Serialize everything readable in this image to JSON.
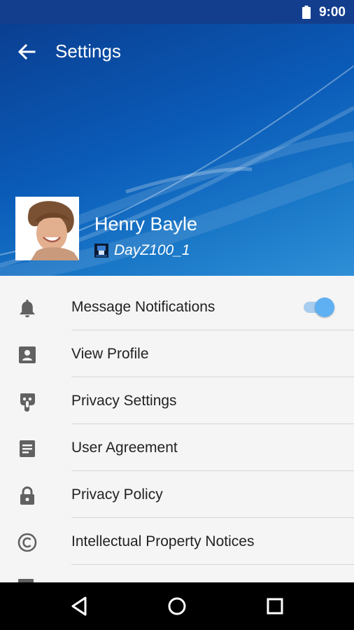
{
  "status_bar": {
    "time": "9:00",
    "battery_icon": "battery-full-icon"
  },
  "header": {
    "title": "Settings",
    "back_icon": "arrow-back-icon",
    "user": {
      "name": "Henry Bayle",
      "handle": "DayZ100_1"
    }
  },
  "settings": {
    "items": [
      {
        "label": "Message Notifications",
        "icon": "bell-icon",
        "toggle_on": true
      },
      {
        "label": "View Profile",
        "icon": "contact-card-icon"
      },
      {
        "label": "Privacy Settings",
        "icon": "privacy-hand-icon"
      },
      {
        "label": "User Agreement",
        "icon": "document-icon"
      },
      {
        "label": "Privacy Policy",
        "icon": "lock-icon"
      },
      {
        "label": "Intellectual Property Notices",
        "icon": "copyright-icon"
      }
    ]
  },
  "nav_bar": {
    "back": "nav-back-icon",
    "home": "nav-home-icon",
    "recents": "nav-recents-icon"
  },
  "colors": {
    "status_bar": "#133e8e",
    "header_start": "#0a3f92",
    "toggle_thumb": "#5fb0f2",
    "toggle_track": "#a8cdee",
    "icon_gray": "#616161"
  }
}
